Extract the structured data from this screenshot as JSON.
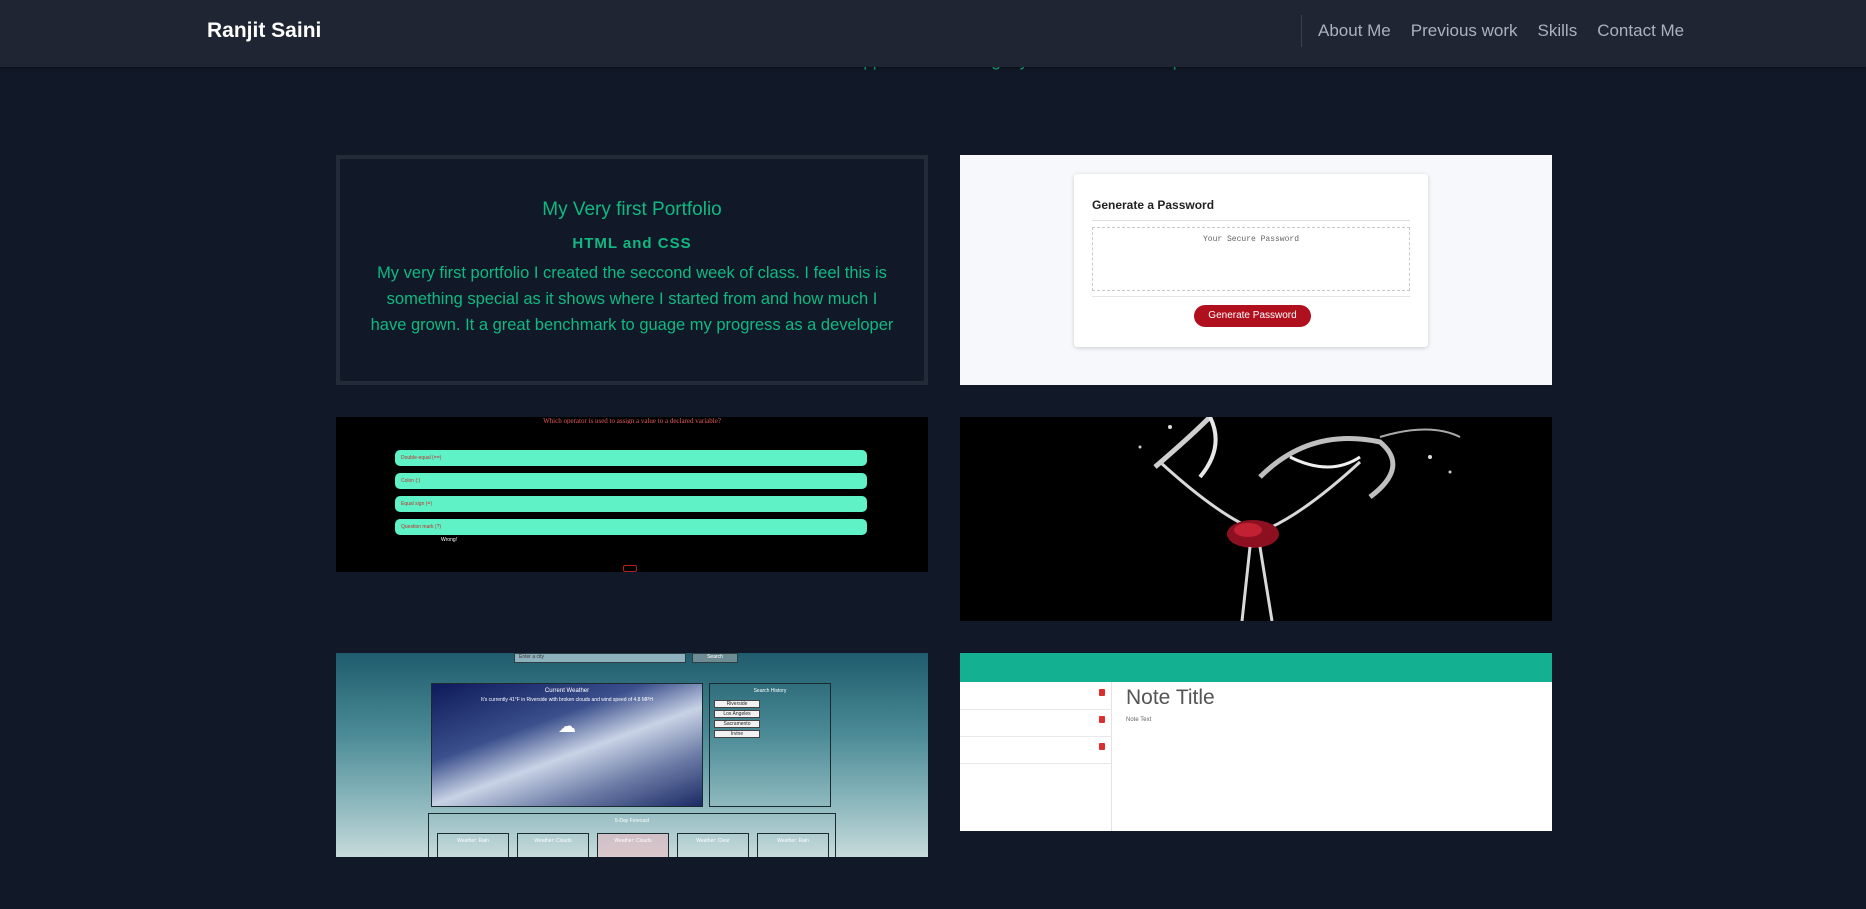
{
  "nav": {
    "brand": "Ranjit Saini",
    "links": [
      "About Me",
      "Previous work",
      "Skills",
      "Contact Me"
    ]
  },
  "intro_text": "These are some of the app I've built during my course at bootcamp.",
  "projects": {
    "portfolio": {
      "title": "My Very first Portfolio",
      "subtitle": "HTML and CSS",
      "description": "My very first portfolio I created the seccond week of class. I feel this is something special as it shows where I started from and how much I have grown. It a great benchmark to guage my progress as a developer"
    },
    "password": {
      "heading": "Generate a Password",
      "placeholder": "Your Secure Password",
      "button": "Generate Password"
    },
    "quiz": {
      "question": "Which operator is used to assign a value to a declared variable?",
      "options": [
        "Double-equal (==)",
        "Colon (:)",
        "Equal sign (=)",
        "Question mark (?)"
      ],
      "status": "Wrong!"
    },
    "weather": {
      "search_placeholder": "Enter a city",
      "search_button": "Search",
      "current_title": "Current Weather",
      "current_desc": "It's currently 41°F in Riverside with broken clouds and wind speed of 4.8 MPH",
      "history_title": "Search History",
      "history": [
        "Riverside",
        "Los Angeles",
        "Sacramento",
        "Irvine"
      ],
      "forecast_title": "5-Day Forecast",
      "forecast_days": [
        "Weather: Rain",
        "Weather: Clouds",
        "Weather: Clouds",
        "Weather: Clear",
        "Weather: Rain"
      ]
    },
    "notes": {
      "title": "Note Title",
      "text": "Note Text"
    }
  },
  "colors": {
    "background": "#111827",
    "navbar": "#1f2532",
    "accent_green": "#10b981",
    "note_header": "#14b092",
    "password_button": "#b0101d"
  }
}
